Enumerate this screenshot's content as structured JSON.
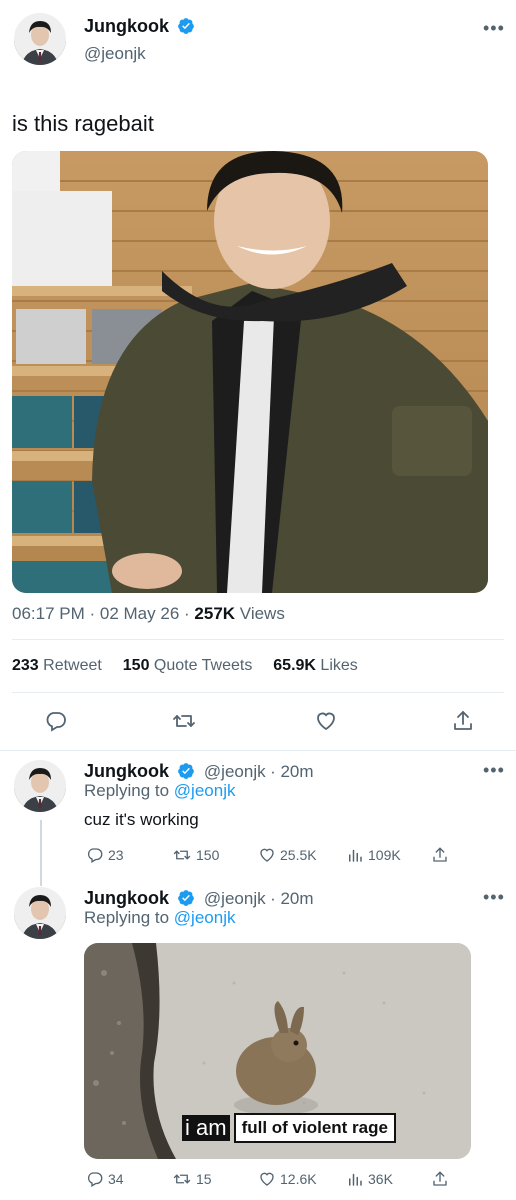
{
  "main_tweet": {
    "author_name": "Jungkook",
    "author_handle": "@jeonjk",
    "text": "is this ragebait",
    "time": "06:17 PM",
    "date": "02 May 26",
    "views_count": "257K",
    "views_label": "Views",
    "retweets_count": "233",
    "retweets_label": "Retweet",
    "quotes_count": "150",
    "quotes_label": "Quote Tweets",
    "likes_count": "65.9K",
    "likes_label": "Likes"
  },
  "replies": [
    {
      "author_name": "Jungkook",
      "author_handle": "@jeonjk",
      "time_ago": "· 20m",
      "replying_prefix": "Replying to",
      "replying_to": "@jeonjk",
      "text": "cuz it's working",
      "reply_count": "23",
      "retweet_count": "150",
      "like_count": "25.5K",
      "view_count": "109K"
    },
    {
      "author_name": "Jungkook",
      "author_handle": "@jeonjk",
      "time_ago": "· 20m",
      "replying_prefix": "Replying to",
      "replying_to": "@jeonjk",
      "meme_caption_a": "i am",
      "meme_caption_b": "full of violent rage",
      "reply_count": "34",
      "retweet_count": "15",
      "like_count": "12.6K",
      "view_count": "36K"
    }
  ],
  "icons": {
    "verified": "verified-badge-icon",
    "more": "more-dots-icon",
    "reply": "reply-icon",
    "retweet": "retweet-icon",
    "like": "heart-icon",
    "share": "share-icon",
    "views": "views-chart-icon"
  },
  "colors": {
    "accent": "#1d9bf0",
    "text_primary": "#0f1419",
    "text_secondary": "#536471",
    "divider": "#e6ecf0"
  }
}
